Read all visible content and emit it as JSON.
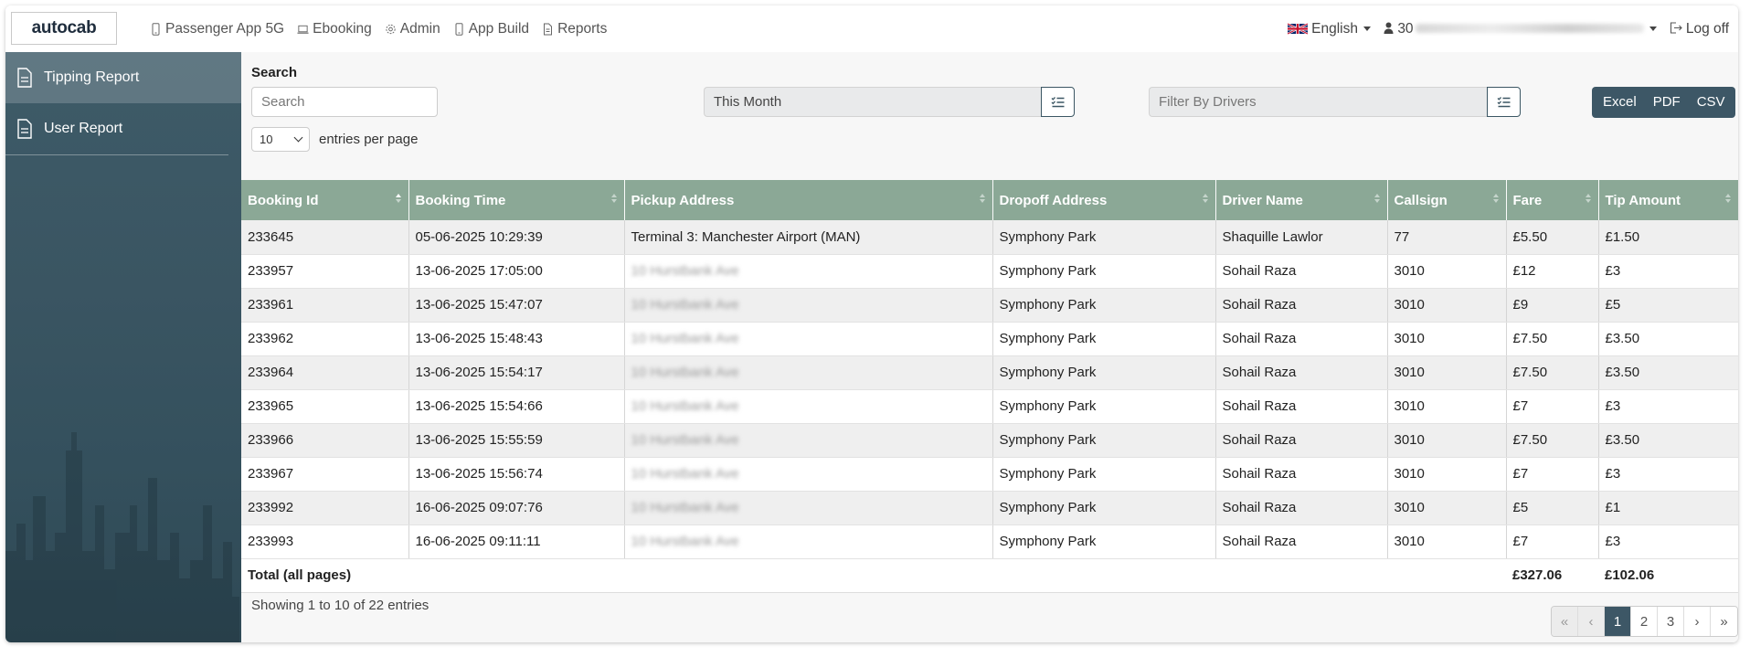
{
  "app": {
    "logo": "autocab"
  },
  "nav": {
    "items": [
      {
        "label": "Passenger App 5G",
        "icon": "phone-icon"
      },
      {
        "label": "Ebooking",
        "icon": "laptop-icon"
      },
      {
        "label": "Admin",
        "icon": "gear-icon"
      },
      {
        "label": "App Build",
        "icon": "phone-icon"
      },
      {
        "label": "Reports",
        "icon": "document-icon"
      }
    ],
    "language": "English",
    "user": "30",
    "logoff": "Log off"
  },
  "sidebar": {
    "items": [
      {
        "label": "Tipping Report",
        "active": true
      },
      {
        "label": "User Report",
        "active": false
      }
    ]
  },
  "filters": {
    "search_label": "Search",
    "search_placeholder": "Search",
    "date_range": "This Month",
    "drivers_placeholder": "Filter By Drivers",
    "entries_value": "10",
    "entries_label": "entries per page"
  },
  "export": {
    "excel": "Excel",
    "pdf": "PDF",
    "csv": "CSV"
  },
  "table": {
    "columns": [
      "Booking Id",
      "Booking Time",
      "Pickup Address",
      "Dropoff Address",
      "Driver Name",
      "Callsign",
      "Fare",
      "Tip Amount"
    ],
    "rows": [
      [
        "233645",
        "05-06-2025 10:29:39",
        "Terminal 3: Manchester Airport (MAN)",
        "Symphony Park",
        "Shaquille Lawlor",
        "77",
        "£5.50",
        "£1.50"
      ],
      [
        "233957",
        "13-06-2025 17:05:00",
        "10 Hurstbank Ave",
        "Symphony Park",
        "Sohail Raza",
        "3010",
        "£12",
        "£3"
      ],
      [
        "233961",
        "13-06-2025 15:47:07",
        "10 Hurstbank Ave",
        "Symphony Park",
        "Sohail Raza",
        "3010",
        "£9",
        "£5"
      ],
      [
        "233962",
        "13-06-2025 15:48:43",
        "10 Hurstbank Ave",
        "Symphony Park",
        "Sohail Raza",
        "3010",
        "£7.50",
        "£3.50"
      ],
      [
        "233964",
        "13-06-2025 15:54:17",
        "10 Hurstbank Ave",
        "Symphony Park",
        "Sohail Raza",
        "3010",
        "£7.50",
        "£3.50"
      ],
      [
        "233965",
        "13-06-2025 15:54:66",
        "10 Hurstbank Ave",
        "Symphony Park",
        "Sohail Raza",
        "3010",
        "£7",
        "£3"
      ],
      [
        "233966",
        "13-06-2025 15:55:59",
        "10 Hurstbank Ave",
        "Symphony Park",
        "Sohail Raza",
        "3010",
        "£7.50",
        "£3.50"
      ],
      [
        "233967",
        "13-06-2025 15:56:74",
        "10 Hurstbank Ave",
        "Symphony Park",
        "Sohail Raza",
        "3010",
        "£7",
        "£3"
      ],
      [
        "233992",
        "16-06-2025 09:07:76",
        "10 Hurstbank Ave",
        "Symphony Park",
        "Sohail Raza",
        "3010",
        "£5",
        "£1"
      ],
      [
        "233993",
        "16-06-2025 09:11:11",
        "10 Hurstbank Ave",
        "Symphony Park",
        "Sohail Raza",
        "3010",
        "£7",
        "£3"
      ]
    ],
    "total_label": "Total (all pages)",
    "total_fare": "£327.06",
    "total_tip": "£102.06"
  },
  "footer": {
    "showing": "Showing 1 to 10 of 22 entries",
    "pages": [
      "«",
      "‹",
      "1",
      "2",
      "3",
      "›",
      "»"
    ],
    "current_page": "1"
  },
  "colors": {
    "header": "#8ba896",
    "accent": "#3d5766"
  }
}
